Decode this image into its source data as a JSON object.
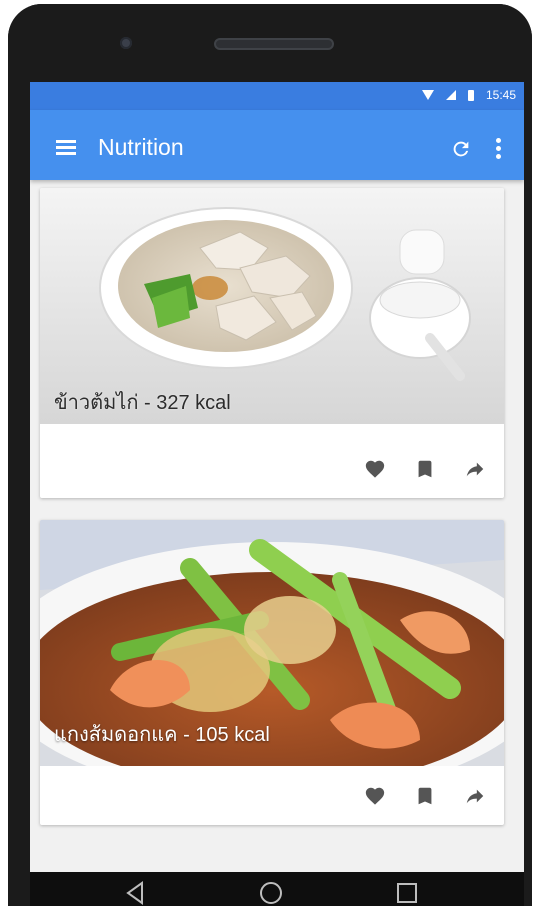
{
  "status_bar": {
    "time": "15:45",
    "icons": [
      "wifi-icon",
      "signal-icon",
      "battery-icon"
    ]
  },
  "app_bar": {
    "title": "Nutrition",
    "menu_icon": "menu-icon",
    "actions": [
      "refresh-icon",
      "more-vert-icon"
    ]
  },
  "cards": [
    {
      "title": "ข้าวต้มไก่ - 327 kcal",
      "image": "rice-porridge-with-chicken",
      "actions": [
        "heart-icon",
        "bookmark-icon",
        "share-icon"
      ]
    },
    {
      "title": "แกงส้มดอกแค - 105 kcal",
      "image": "sour-curry-with-vegetables-and-shrimp",
      "actions": [
        "heart-icon",
        "bookmark-icon",
        "share-icon"
      ]
    }
  ],
  "nav_bar": {
    "buttons": [
      "back-icon",
      "home-icon",
      "recents-icon"
    ]
  },
  "colors": {
    "status_bar": "#3a7de0",
    "app_bar": "#4590ee",
    "background": "#f1f1f1",
    "card": "#ffffff",
    "icon": "#555555"
  }
}
